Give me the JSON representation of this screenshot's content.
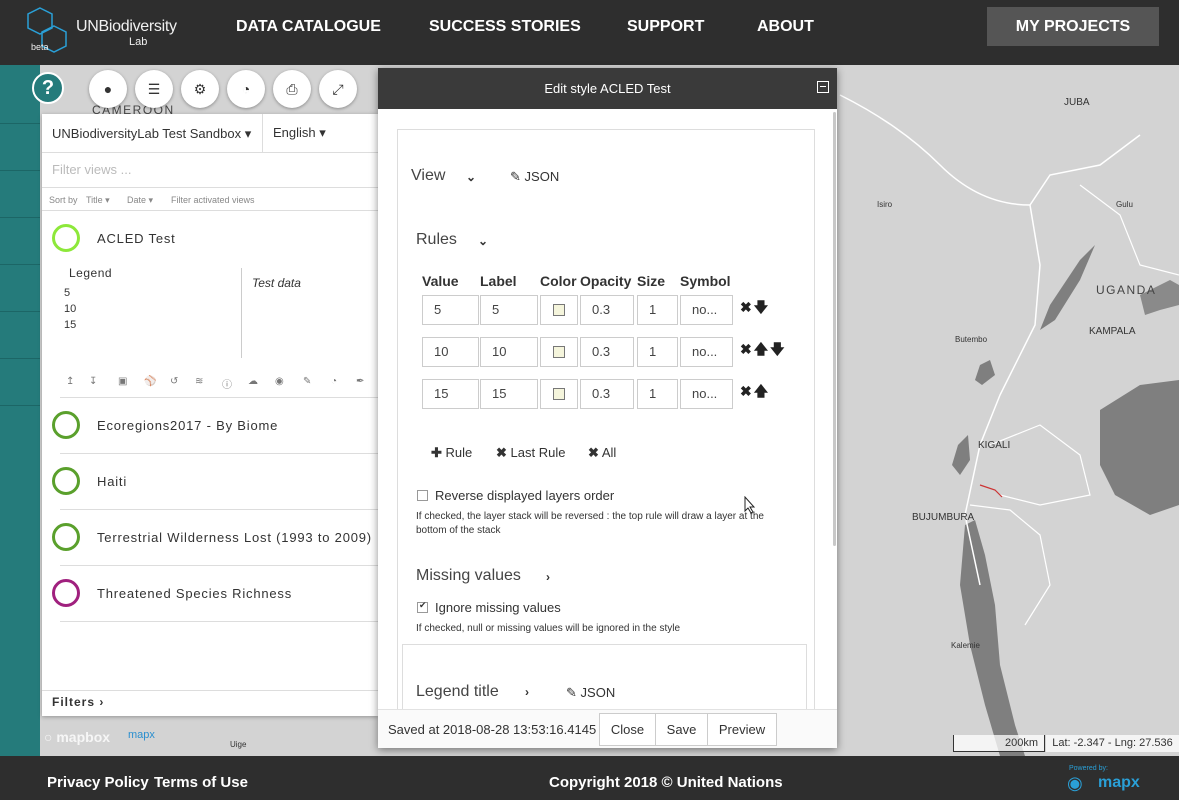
{
  "header": {
    "logo_un": "UNBiodiversity",
    "logo_lab": "Lab",
    "logo_beta": "beta",
    "nav": [
      "DATA CATALOGUE",
      "SUCCESS STORIES",
      "SUPPORT",
      "ABOUT"
    ],
    "my_projects": "MY PROJECTS"
  },
  "sidebar": {
    "help": "?"
  },
  "map": {
    "labels": [
      "CAMEROON",
      "JUBA",
      "Isiro",
      "Gulu",
      "UGANDA",
      "KAMPALA",
      "Butembo",
      "KIGALI",
      "BUJUMBURA",
      "Kalemie",
      "Uige"
    ],
    "land_color": "#d3d3d3",
    "water_color": "#7f7f7f",
    "scale": "200km",
    "latlng": "Lat: -2.347 - Lng: 27.536"
  },
  "views_panel": {
    "project": "UNBiodiversityLab Test Sandbox",
    "language": "English",
    "filter_placeholder": "Filter views ...",
    "sort_label": "Sort by",
    "sort_title": "Title",
    "sort_date": "Date",
    "filter_activated": "Filter activated views",
    "views": [
      {
        "title": "ACLED Test",
        "color": "#8de83a"
      },
      {
        "title": "Ecoregions2017 - By Biome",
        "color": "#5aa02c"
      },
      {
        "title": "Haiti",
        "color": "#5aa02c"
      },
      {
        "title": "Terrestrial Wilderness Lost (1993 to 2009)",
        "color": "#5aa02c"
      },
      {
        "title": "Threatened Species Richness",
        "color": "#a0207e"
      }
    ],
    "legend_title": "Legend",
    "legend_values": [
      "5",
      "10",
      "15"
    ],
    "legend_desc": "Test data",
    "filters": "Filters"
  },
  "editor": {
    "title": "Edit style ACLED Test",
    "view_section": "View",
    "json": "JSON",
    "rules_section": "Rules",
    "columns": [
      "Value",
      "Label",
      "Color",
      "Opacity",
      "Size",
      "Symbol"
    ],
    "rules": [
      {
        "value": "5",
        "label": "5",
        "opacity": "0.3",
        "size": "1",
        "symbol": "no..."
      },
      {
        "value": "10",
        "label": "10",
        "opacity": "0.3",
        "size": "1",
        "symbol": "no..."
      },
      {
        "value": "15",
        "label": "15",
        "opacity": "0.3",
        "size": "1",
        "symbol": "no..."
      }
    ],
    "add_rule": "Rule",
    "remove_last": "Last Rule",
    "remove_all": "All",
    "reverse_label": "Reverse displayed layers order",
    "reverse_help": "If checked, the layer stack will be reversed : the top rule will draw a layer at the bottom of the stack",
    "missing_section": "Missing values",
    "ignore_label": "Ignore missing values",
    "ignore_help": "If checked, null or missing values will be ignored in the style",
    "legend_section": "Legend title",
    "saved": "Saved at 2018-08-28 13:53:16.4145",
    "close": "Close",
    "save": "Save",
    "preview": "Preview"
  },
  "footer": {
    "privacy": "Privacy Policy",
    "terms": "Terms of Use",
    "copyright": "Copyright 2018 © United Nations",
    "powered": "Powered by:",
    "mapx": "mapx",
    "mapbox": "mapbox"
  }
}
